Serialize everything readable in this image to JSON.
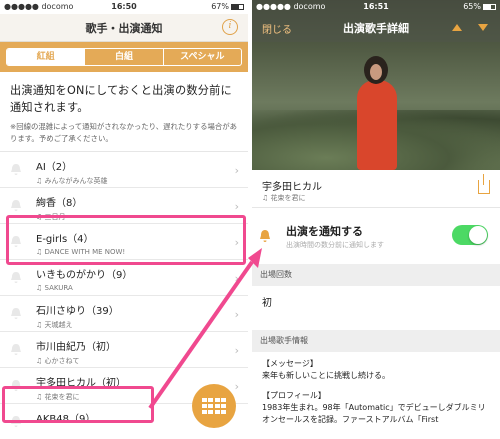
{
  "left": {
    "status": {
      "carrier": "●●●●● docomo",
      "time": "16:50",
      "battery": "67%"
    },
    "title": "歌手・出演通知",
    "info_label": "i",
    "tabs": [
      {
        "label": "紅組",
        "active": true
      },
      {
        "label": "白組",
        "active": false
      },
      {
        "label": "スペシャル",
        "active": false
      }
    ],
    "notice_main": "出演通知をONにしておくと出演の数分前に通知されます。",
    "notice_sub": "※回線の混雑によって通知がされなかったり、遅れたりする場合があります。予めご了承ください。",
    "rows": [
      {
        "name": "AI（2）",
        "song": "♫ みんながみんな英雄"
      },
      {
        "name": "絢香（8）",
        "song": "♫ 三日月"
      },
      {
        "name": "E-girls（4）",
        "song": "♫ DANCE WITH ME NOW!"
      },
      {
        "name": "いきものがかり（9）",
        "song": "♫ SAKURA"
      },
      {
        "name": "石川さゆり（39）",
        "song": "♫ 天城越え"
      },
      {
        "name": "市川由紀乃（初）",
        "song": "♫ 心かさねて"
      },
      {
        "name": "宇多田ヒカル（初）",
        "song": "♫ 花束を君に"
      },
      {
        "name": "AKB48（9）",
        "song": ""
      }
    ]
  },
  "right": {
    "status": {
      "carrier": "●●●●● docomo",
      "time": "16:51",
      "battery": "65%"
    },
    "close_label": "閉じる",
    "title": "出演歌手詳細",
    "artist": "宇多田ヒカル",
    "song": "♫ 花束を君に",
    "notify_title": "出演を通知する",
    "notify_sub": "出演時間の数分前に通知します",
    "notify_on": true,
    "count_heading": "出場回数",
    "count_value": "初",
    "info_heading": "出場歌手情報",
    "message_label": "【メッセージ】",
    "message_text": "来年も新しいことに挑戦し続ける。",
    "profile_label": "【プロフィール】",
    "profile_text": "1983年生まれ。98年「Automatic」でデビューしダブルミリオンセールスを記録。ファーストアルバム「First"
  },
  "colors": {
    "accent": "#e8a441",
    "highlight": "#f0498f",
    "toggle_on": "#4cd964"
  }
}
